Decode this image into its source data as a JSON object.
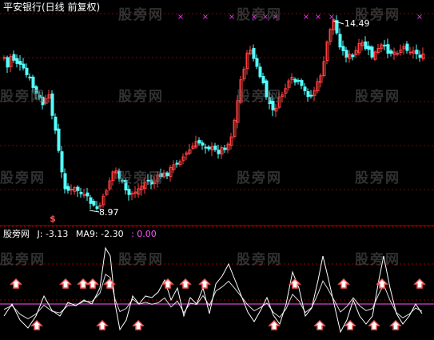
{
  "window": {
    "title": "平安银行(日线 前复权)"
  },
  "watermark": "股旁网",
  "price_panel": {
    "high_label": "14.49",
    "low_label": "8.97",
    "marker_glyph": "×",
    "low_signal_glyph": "$"
  },
  "indicator_panel": {
    "name": "股旁网",
    "j_label": "J: -3.13",
    "ma9_label": "MA9: -2.30",
    "zero_label": ": 0.00"
  },
  "colors": {
    "background": "#000000",
    "bull": "#ff4040",
    "bear": "#55ffff",
    "grid": "#8b0000",
    "marker": "#ff33ff",
    "signal": "#ff5555",
    "ma9": "#ff55ff",
    "j_line": "#ffffff",
    "label_text": "#ffffff"
  }
}
